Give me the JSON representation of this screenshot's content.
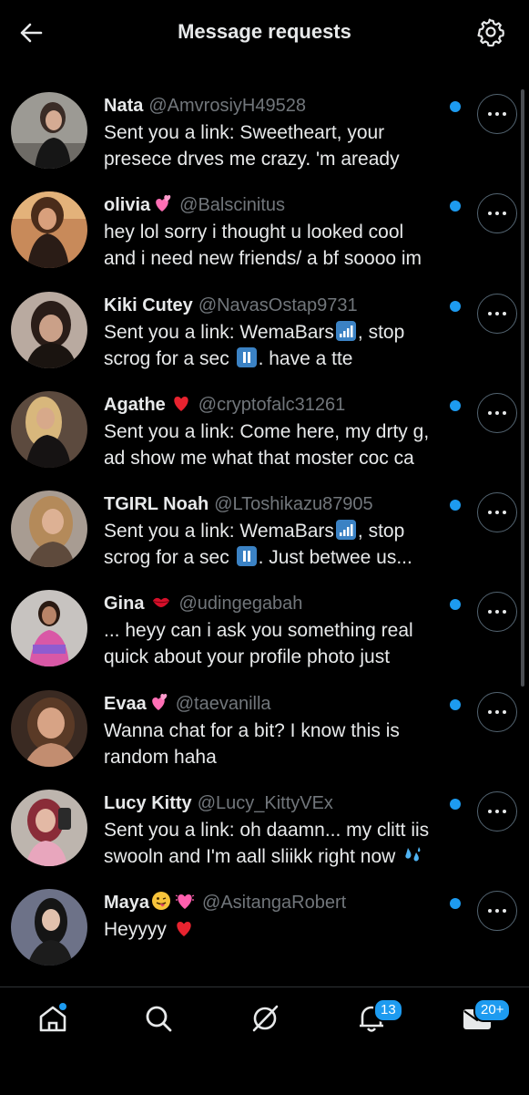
{
  "header": {
    "title": "Message requests"
  },
  "requests": [
    {
      "name": "Nata",
      "handle": "@AmvrosiyH49528",
      "line1": "Sent you a link: Sweetheart, your",
      "line2": "presece drves me crazy. 'm aready"
    },
    {
      "name": "olivia",
      "handle": "@Balscinitus",
      "line1": "hey lol sorry i thought u looked cool",
      "line2": "and i need new friends/ a bf soooo im"
    },
    {
      "name": "Kiki Cutey",
      "handle": "@NavasOstap9731",
      "line1a": "Sent you a link: WemaBars",
      "line1b": ", stop",
      "line2a": "scrog for a sec",
      "line2b": ".  have a tte"
    },
    {
      "name": "Agathe",
      "handle": "@cryptofalc31261",
      "line1": "Sent you a link: Come here, my drty g,",
      "line2": "ad show me what that moster coc ca"
    },
    {
      "name": "TGIRL Noah",
      "handle": "@LToshikazu87905",
      "line1a": "Sent you a link: WemaBars",
      "line1b": ", stop",
      "line2a": "scrog for a sec",
      "line2b": ". Just betwee us..."
    },
    {
      "name": "Gina",
      "handle": "@udingegabah",
      "line1": "... heyy can i ask you something real",
      "line2": "quick about your profile photo just"
    },
    {
      "name": "Evaa",
      "handle": "@taevanilla",
      "line1": "Wanna chat for a bit? I know this is",
      "line2": "random haha"
    },
    {
      "name": "Lucy Kitty",
      "handle": "@Lucy_KittyVEx",
      "line1": "Sent you a link: oh daamn... my clitt iis",
      "line2": "swooln and I'm aall sliikk right now"
    },
    {
      "name": "Maya",
      "handle": "@AsitangaRobert",
      "line1": "Heyyyy",
      "line2": ""
    }
  ],
  "tabbar": {
    "notifications_badge": "13",
    "messages_badge": "20+"
  },
  "colors": {
    "accent": "#1d9bf0",
    "background": "#000000",
    "text": "#e7e9ea",
    "muted": "#71767b"
  },
  "icons": [
    "back-arrow-icon",
    "gear-icon",
    "more-icon",
    "home-icon",
    "search-icon",
    "grok-icon",
    "bell-icon",
    "envelope-icon"
  ]
}
